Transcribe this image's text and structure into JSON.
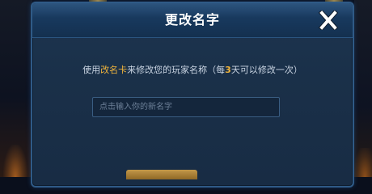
{
  "dialog": {
    "title": "更改名字",
    "close_icon": "close-icon",
    "message": {
      "prefix": "使用",
      "item_name": "改名卡",
      "middle": "来修改您的玩家名称（每",
      "days": "3",
      "suffix": "天可以修改一次）"
    },
    "input": {
      "value": "",
      "placeholder": "点击输入你的新名字"
    }
  },
  "colors": {
    "highlight": "#f0b43c",
    "dialog_border": "#2f5a86",
    "dialog_bg": "#1a3049",
    "text": "#c9d4e2",
    "title": "#ffffff"
  }
}
